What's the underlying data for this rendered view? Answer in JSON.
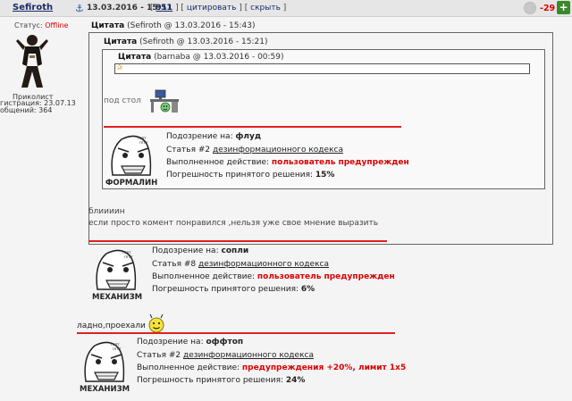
{
  "header": {
    "user": "Sefiroth",
    "date": "13.03.2016 - 15:51",
    "post_number": "911",
    "bracket_open": "[",
    "bracket_mid": "] [",
    "bracket_close": "]",
    "quote_link": "цитировать",
    "hide_link": "скрыть",
    "rating": "-29",
    "plus": "+"
  },
  "sidebar": {
    "status_label": "Статус:",
    "status_value": "Offline",
    "title": "Приколист",
    "registration": "гистрация: 23.07.13",
    "messages": "общений: 364"
  },
  "quotes": {
    "q1_label": "Цитата",
    "q1_meta": "(Sefiroth @ 13.03.2016 - 15:43)",
    "q2_label": "Цитата",
    "q2_meta": "(Sefiroth @ 13.03.2016 - 15:21)",
    "q3_label": "Цитата",
    "q3_meta": "(barnaba @ 13.03.2016 - 00:59)",
    "pod_stol": "под стол"
  },
  "warnings": [
    {
      "badge": "ФОРМАЛИН",
      "suspicion_label": "Подозрение на:",
      "suspicion": "флуд",
      "article_prefix": "Статья #2",
      "article": "дезинформационного кодекса",
      "action_label": "Выполненное действие:",
      "action": "пользователь предупрежден",
      "error_label": "Погрешность принятого решения:",
      "error": "15%"
    },
    {
      "badge": "МЕХАНИЗМ",
      "suspicion_label": "Подозрение на:",
      "suspicion": "сопли",
      "article_prefix": "Статья #8",
      "article": "дезинформационного кодекса",
      "action_label": "Выполненное действие:",
      "action": "пользователь предупрежден",
      "error_label": "Погрешность принятого решения:",
      "error": "6%"
    },
    {
      "badge": "МЕХАНИЗМ",
      "suspicion_label": "Подозрение на:",
      "suspicion": "оффтоп",
      "article_prefix": "Статья #2",
      "article": "дезинформационного кодекса",
      "action_label": "Выполненное действие:",
      "action": "предупреждения +20%, лимит 1х5",
      "error_label": "Погрешность принятого решения:",
      "error": "24%"
    }
  ],
  "texts": {
    "blii": "блиииин",
    "comment": "если просто комент понравился ,нельзя уже свое мнение выразить",
    "ladno": "ладно,проехали"
  },
  "colors": {
    "accent_red": "#d00",
    "link": "#1a2a6a",
    "rating": "#d00"
  }
}
